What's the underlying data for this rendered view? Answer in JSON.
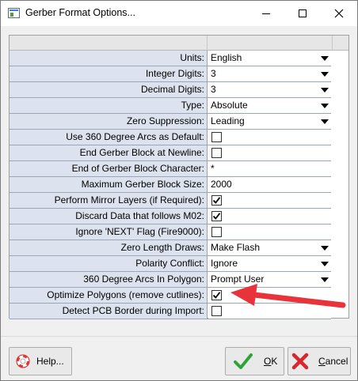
{
  "window": {
    "title": "Gerber Format Options..."
  },
  "rows": [
    {
      "label": "Units:",
      "type": "combo",
      "value": "English"
    },
    {
      "label": "Integer Digits:",
      "type": "combo",
      "value": "3"
    },
    {
      "label": "Decimal Digits:",
      "type": "combo",
      "value": "3"
    },
    {
      "label": "Type:",
      "type": "combo",
      "value": "Absolute"
    },
    {
      "label": "Zero Suppression:",
      "type": "combo",
      "value": "Leading"
    },
    {
      "label": "Use 360 Degree Arcs as Default:",
      "type": "checkbox",
      "checked": false
    },
    {
      "label": "End Gerber Block at Newline:",
      "type": "checkbox",
      "checked": false
    },
    {
      "label": "End of Gerber Block Character:",
      "type": "text",
      "value": "*"
    },
    {
      "label": "Maximum Gerber Block Size:",
      "type": "text",
      "value": "2000"
    },
    {
      "label": "Perform Mirror Layers (if Required):",
      "type": "checkbox",
      "checked": true
    },
    {
      "label": "Discard Data that follows M02:",
      "type": "checkbox",
      "checked": true
    },
    {
      "label": "Ignore 'NEXT' Flag (Fire9000):",
      "type": "checkbox",
      "checked": false
    },
    {
      "label": "Zero Length Draws:",
      "type": "combo",
      "value": "Make Flash"
    },
    {
      "label": "Polarity Conflict:",
      "type": "combo",
      "value": "Ignore"
    },
    {
      "label": "360 Degree Arcs In Polygon:",
      "type": "combo",
      "value": "Prompt User"
    },
    {
      "label": "Optimize Polygons (remove cutlines):",
      "type": "checkbox",
      "checked": true
    },
    {
      "label": "Detect PCB Border during Import:",
      "type": "checkbox",
      "checked": false
    }
  ],
  "buttons": {
    "help": "Help...",
    "ok": "OK",
    "cancel": "Cancel"
  },
  "icons": {
    "help": "lifebuoy-icon",
    "ok": "green-checkmark-icon",
    "cancel": "red-x-icon",
    "annotation": "red-arrow"
  },
  "colors": {
    "label_bg": "#dce3ee",
    "annotation_arrow": "#e8333a",
    "ok_check": "#2fa33a",
    "cancel_x": "#d9262c"
  }
}
